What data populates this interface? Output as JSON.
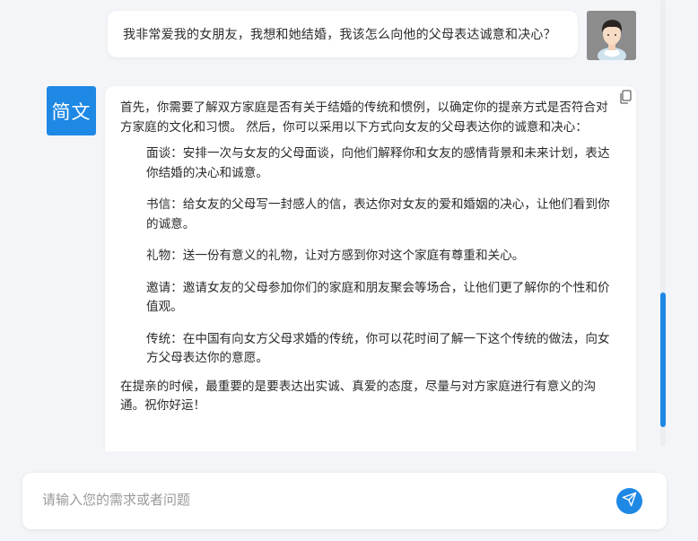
{
  "user_message": {
    "text": "我非常爱我的女朋友，我想和她结婚，我该怎么向他的父母表达诚意和决心？",
    "avatar_icon": "user-avatar-icon"
  },
  "bot": {
    "avatar_text": "简文",
    "avatar_color": "#1e88e5",
    "copy_icon": "copy-icon",
    "intro": "首先，你需要了解双方家庭是否有关于结婚的传统和惯例，以确定你的提亲方式是否符合对方家庭的文化和习惯。 然后，你可以采用以下方式向女友的父母表达你的诚意和决心：",
    "items": [
      "面谈：安排一次与女友的父母面谈，向他们解释你和女友的感情背景和未来计划，表达你结婚的决心和诚意。",
      "书信：给女友的父母写一封感人的信，表达你对女友的爱和婚姻的决心，让他们看到你的诚意。",
      "礼物：送一份有意义的礼物，让对方感到你对这个家庭有尊重和关心。",
      "邀请：邀请女友的父母参加你们的家庭和朋友聚会等场合，让他们更了解你的个性和价值观。",
      "传统：在中国有向女方父母求婚的传统，你可以花时间了解一下这个传统的做法，向女方父母表达你的意愿。"
    ],
    "outro": "在提亲的时候，最重要的是要表达出实诚、真爱的态度，尽量与对方家庭进行有意义的沟通。祝你好运！"
  },
  "input": {
    "placeholder": "请输入您的需求或者问题",
    "value": "",
    "send_icon": "send-icon"
  },
  "colors": {
    "accent": "#1e88e5",
    "background": "#f3f5f8"
  }
}
